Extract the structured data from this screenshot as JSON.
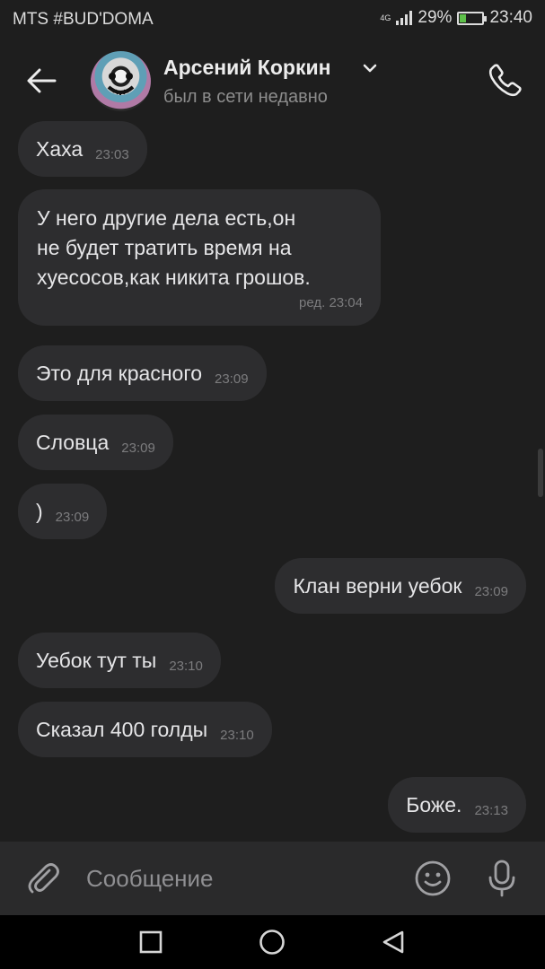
{
  "status_bar": {
    "carrier": "MTS #BUD'DOMA",
    "network": "4G",
    "battery_percent": "29%",
    "battery_level": 0.29,
    "time": "23:40",
    "battery_color": "#5ec04a"
  },
  "header": {
    "contact_name": "Арсений Коркин",
    "contact_status": "был в сети недавно",
    "icons": [
      "back-arrow-icon",
      "chevron-down-icon",
      "phone-icon"
    ]
  },
  "messages": [
    {
      "direction": "incoming",
      "text": "Хаха",
      "time": "23:03"
    },
    {
      "direction": "incoming",
      "text": "У него другие дела есть,он\nне будет тратить время на\nхуесосов,как никита грошов.",
      "time": "ред. 23:04"
    },
    {
      "direction": "incoming",
      "text": "Это для красного",
      "time": "23:09"
    },
    {
      "direction": "incoming",
      "text": "Словца",
      "time": "23:09"
    },
    {
      "direction": "incoming",
      "text": ")",
      "time": "23:09"
    },
    {
      "direction": "outgoing",
      "text": "Клан верни уебок",
      "time": "23:09"
    },
    {
      "direction": "incoming",
      "text": "Уебок тут ты",
      "time": "23:10"
    },
    {
      "direction": "incoming",
      "text": "Сказал 400 голды",
      "time": "23:10"
    },
    {
      "direction": "outgoing",
      "text": "Боже.",
      "time": "23:13"
    }
  ],
  "composer": {
    "placeholder": "Сообщение",
    "icons": [
      "paperclip-icon",
      "emoji-icon",
      "microphone-icon"
    ]
  },
  "colors": {
    "background": "#1e1e1e",
    "bubble": "#2d2d2f",
    "composer": "#2a2a2b",
    "text": "#e5e5e7",
    "secondary_text": "#8d8d8d"
  },
  "nav_bar": {
    "icons": [
      "recents-square-icon",
      "home-circle-icon",
      "back-triangle-icon"
    ]
  }
}
